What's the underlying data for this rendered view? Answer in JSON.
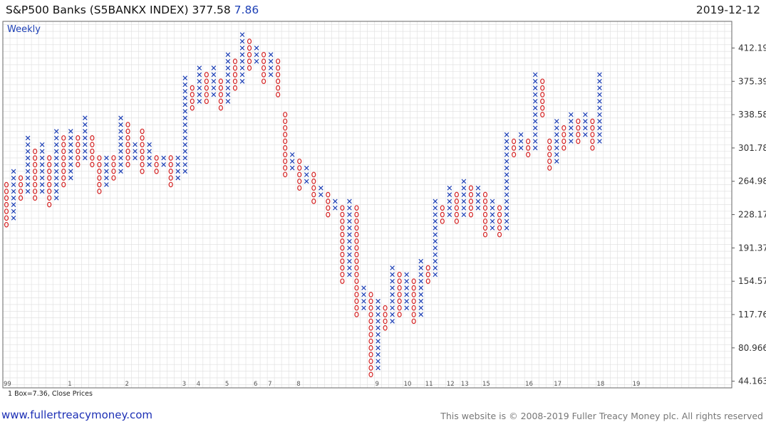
{
  "header": {
    "title": "S&P500 Banks  (S5BANKX INDEX) 377.58",
    "change": "7.86",
    "date": "2019-12-12"
  },
  "footer": {
    "website": "www.fullertreacymoney.com",
    "copyright": "This website is © 2008-2019 Fuller Treacy Money plc. All rights reserved"
  },
  "colors": {
    "x": "#1c3fb5",
    "o": "#d42424",
    "grid": "#dedede",
    "axis": "#555555"
  },
  "chart_data": {
    "type": "point-and-figure",
    "period_label": "Weekly",
    "box_note": "1 Box=7.36, Close Prices",
    "box_size": 7.36,
    "y_ticks": [
      412.19,
      375.39,
      338.58,
      301.78,
      264.98,
      228.17,
      191.37,
      154.57,
      117.76,
      80.966,
      44.163
    ],
    "y_tick_labels": [
      "412.19",
      "375.39",
      "338.58",
      "301.78",
      "264.98",
      "228.17",
      "191.37",
      "154.57",
      "117.76",
      "80.966",
      "44.163"
    ],
    "ylim": [
      36.803,
      441.63
    ],
    "column_count": 102,
    "x_labels": [
      {
        "col": 0,
        "label": "99"
      },
      {
        "col": 9,
        "label": "1"
      },
      {
        "col": 17,
        "label": "2"
      },
      {
        "col": 25,
        "label": "3"
      },
      {
        "col": 27,
        "label": "4"
      },
      {
        "col": 31,
        "label": "5"
      },
      {
        "col": 35,
        "label": "6"
      },
      {
        "col": 37,
        "label": "7"
      },
      {
        "col": 41,
        "label": "8"
      },
      {
        "col": 52,
        "label": "9"
      },
      {
        "col": 56,
        "label": "10"
      },
      {
        "col": 59,
        "label": "11"
      },
      {
        "col": 62,
        "label": "12"
      },
      {
        "col": 64,
        "label": "13"
      },
      {
        "col": 67,
        "label": "15"
      },
      {
        "col": 73,
        "label": "16"
      },
      {
        "col": 77,
        "label": "17"
      },
      {
        "col": 83,
        "label": "18"
      },
      {
        "col": 88,
        "label": "19"
      }
    ],
    "columns": [
      {
        "t": "O",
        "lo": 217.0,
        "hi": 257.6
      },
      {
        "t": "X",
        "lo": 224.4,
        "hi": 272.4
      },
      {
        "t": "O",
        "lo": 246.5,
        "hi": 265.0
      },
      {
        "t": "X",
        "lo": 253.9,
        "hi": 309.2
      },
      {
        "t": "O",
        "lo": 246.5,
        "hi": 294.4
      },
      {
        "t": "X",
        "lo": 253.9,
        "hi": 301.8
      },
      {
        "t": "O",
        "lo": 239.2,
        "hi": 294.4
      },
      {
        "t": "X",
        "lo": 246.5,
        "hi": 316.5
      },
      {
        "t": "O",
        "lo": 261.3,
        "hi": 309.2
      },
      {
        "t": "X",
        "lo": 268.7,
        "hi": 323.9
      },
      {
        "t": "O",
        "lo": 283.4,
        "hi": 316.5
      },
      {
        "t": "X",
        "lo": 290.8,
        "hi": 331.3
      },
      {
        "t": "O",
        "lo": 283.4,
        "hi": 316.5
      },
      {
        "t": "O",
        "lo": 253.9,
        "hi": 287.1
      },
      {
        "t": "X",
        "lo": 261.3,
        "hi": 294.4
      },
      {
        "t": "O",
        "lo": 268.7,
        "hi": 287.1
      },
      {
        "t": "X",
        "lo": 276.0,
        "hi": 331.3
      },
      {
        "t": "O",
        "lo": 283.4,
        "hi": 323.9
      },
      {
        "t": "X",
        "lo": 290.8,
        "hi": 309.2
      },
      {
        "t": "O",
        "lo": 276.0,
        "hi": 316.5
      },
      {
        "t": "X",
        "lo": 283.4,
        "hi": 301.8
      },
      {
        "t": "O",
        "lo": 276.0,
        "hi": 294.4
      },
      {
        "t": "X",
        "lo": 283.4,
        "hi": 294.4
      },
      {
        "t": "O",
        "lo": 261.3,
        "hi": 287.1
      },
      {
        "t": "X",
        "lo": 268.7,
        "hi": 294.4
      },
      {
        "t": "X",
        "lo": 276.0,
        "hi": 375.4
      },
      {
        "t": "O",
        "lo": 346.0,
        "hi": 368.0
      },
      {
        "t": "X",
        "lo": 353.3,
        "hi": 390.1
      },
      {
        "t": "O",
        "lo": 353.3,
        "hi": 382.8
      },
      {
        "t": "X",
        "lo": 360.7,
        "hi": 390.1
      },
      {
        "t": "O",
        "lo": 346.0,
        "hi": 375.4
      },
      {
        "t": "X",
        "lo": 353.3,
        "hi": 404.9
      },
      {
        "t": "O",
        "lo": 368.0,
        "hi": 397.5
      },
      {
        "t": "X",
        "lo": 375.4,
        "hi": 427.0
      },
      {
        "t": "O",
        "lo": 390.1,
        "hi": 419.6
      },
      {
        "t": "X",
        "lo": 397.5,
        "hi": 412.2
      },
      {
        "t": "O",
        "lo": 375.4,
        "hi": 404.9
      },
      {
        "t": "X",
        "lo": 382.8,
        "hi": 404.9
      },
      {
        "t": "O",
        "lo": 360.7,
        "hi": 397.5
      },
      {
        "t": "O",
        "lo": 272.4,
        "hi": 338.6
      },
      {
        "t": "X",
        "lo": 279.7,
        "hi": 294.4
      },
      {
        "t": "O",
        "lo": 257.6,
        "hi": 287.1
      },
      {
        "t": "X",
        "lo": 264.9,
        "hi": 279.7
      },
      {
        "t": "O",
        "lo": 242.9,
        "hi": 272.4
      },
      {
        "t": "X",
        "lo": 250.2,
        "hi": 257.6
      },
      {
        "t": "O",
        "lo": 228.1,
        "hi": 250.2
      },
      {
        "t": "X",
        "lo": 235.5,
        "hi": 242.9
      },
      {
        "t": "O",
        "lo": 154.6,
        "hi": 235.5
      },
      {
        "t": "X",
        "lo": 161.9,
        "hi": 242.9
      },
      {
        "t": "O",
        "lo": 117.8,
        "hi": 235.5
      },
      {
        "t": "X",
        "lo": 125.1,
        "hi": 147.2
      },
      {
        "t": "O",
        "lo": 51.5,
        "hi": 139.8
      },
      {
        "t": "X",
        "lo": 58.9,
        "hi": 132.5
      },
      {
        "t": "O",
        "lo": 103.0,
        "hi": 125.1
      },
      {
        "t": "X",
        "lo": 110.4,
        "hi": 169.3
      },
      {
        "t": "O",
        "lo": 117.8,
        "hi": 161.9
      },
      {
        "t": "X",
        "lo": 125.1,
        "hi": 161.9
      },
      {
        "t": "O",
        "lo": 110.4,
        "hi": 154.6
      },
      {
        "t": "X",
        "lo": 117.8,
        "hi": 176.7
      },
      {
        "t": "O",
        "lo": 154.6,
        "hi": 169.3
      },
      {
        "t": "X",
        "lo": 161.9,
        "hi": 242.9
      },
      {
        "t": "O",
        "lo": 220.8,
        "hi": 235.5
      },
      {
        "t": "X",
        "lo": 228.1,
        "hi": 257.6
      },
      {
        "t": "O",
        "lo": 220.8,
        "hi": 250.2
      },
      {
        "t": "X",
        "lo": 228.1,
        "hi": 264.9
      },
      {
        "t": "O",
        "lo": 228.1,
        "hi": 257.6
      },
      {
        "t": "X",
        "lo": 235.5,
        "hi": 257.6
      },
      {
        "t": "O",
        "lo": 206.1,
        "hi": 250.2
      },
      {
        "t": "X",
        "lo": 213.4,
        "hi": 242.9
      },
      {
        "t": "O",
        "lo": 206.1,
        "hi": 235.5
      },
      {
        "t": "X",
        "lo": 213.4,
        "hi": 316.5
      },
      {
        "t": "O",
        "lo": 294.4,
        "hi": 309.2
      },
      {
        "t": "X",
        "lo": 301.8,
        "hi": 316.5
      },
      {
        "t": "O",
        "lo": 294.4,
        "hi": 309.2
      },
      {
        "t": "X",
        "lo": 301.8,
        "hi": 382.8
      },
      {
        "t": "O",
        "lo": 338.6,
        "hi": 375.4
      },
      {
        "t": "O",
        "lo": 279.7,
        "hi": 309.2
      },
      {
        "t": "X",
        "lo": 287.1,
        "hi": 331.3
      },
      {
        "t": "O",
        "lo": 301.8,
        "hi": 323.9
      },
      {
        "t": "X",
        "lo": 309.2,
        "hi": 338.6
      },
      {
        "t": "O",
        "lo": 309.2,
        "hi": 331.3
      },
      {
        "t": "X",
        "lo": 316.5,
        "hi": 338.6
      },
      {
        "t": "O",
        "lo": 301.8,
        "hi": 331.3
      },
      {
        "t": "X",
        "lo": 309.2,
        "hi": 382.8
      }
    ]
  }
}
